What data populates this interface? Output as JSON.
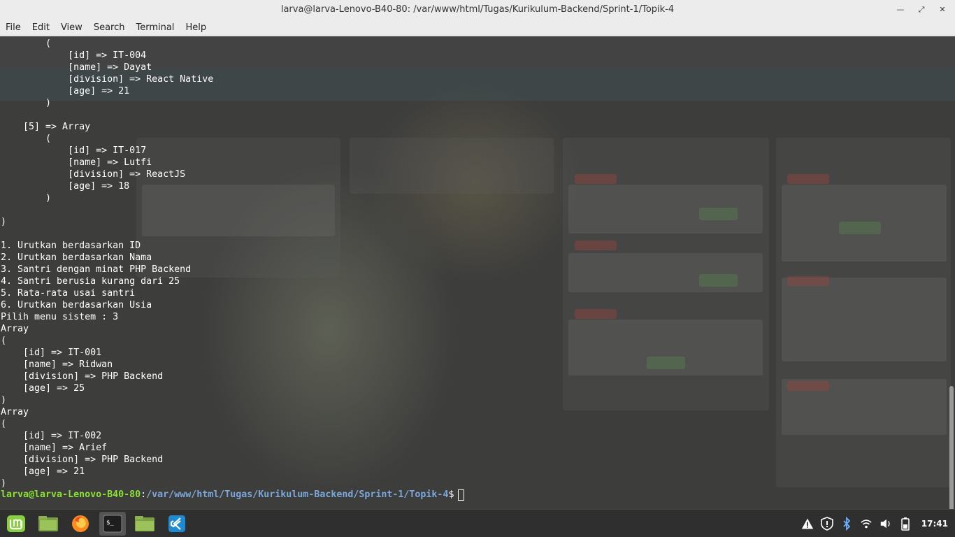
{
  "window": {
    "title": "larva@larva-Lenovo-B40-80: /var/www/html/Tugas/Kurikulum-Backend/Sprint-1/Topik-4"
  },
  "menu": [
    "File",
    "Edit",
    "View",
    "Search",
    "Terminal",
    "Help"
  ],
  "terminal": {
    "output": "        (\n            [id] => IT-004\n            [name] => Dayat\n            [division] => React Native\n            [age] => 21\n        )\n\n    [5] => Array\n        (\n            [id] => IT-017\n            [name] => Lutfi\n            [division] => ReactJS\n            [age] => 18\n        )\n\n)\n\n1. Urutkan berdasarkan ID\n2. Urutkan berdasarkan Nama\n3. Santri dengan minat PHP Backend\n4. Santri berusia kurang dari 25\n5. Rata-rata usai santri\n6. Urutkan berdasarkan Usia\nPilih menu sistem : 3\nArray\n(\n    [id] => IT-001\n    [name] => Ridwan\n    [division] => PHP Backend\n    [age] => 25\n)\nArray\n(\n    [id] => IT-002\n    [name] => Arief\n    [division] => PHP Backend\n    [age] => 21\n)",
    "prompt_user": "larva@larva-Lenovo-B40-80",
    "prompt_sep": ":",
    "prompt_path": "/var/www/html/Tugas/Kurikulum-Backend/Sprint-1/Topik-4",
    "prompt_dollar": "$"
  },
  "taskbar": {
    "apps": [
      "mint-menu-icon",
      "files-icon",
      "firefox-icon",
      "terminal-icon",
      "folder-icon",
      "vscode-icon"
    ],
    "clock": "17:41"
  },
  "colors": {
    "prompt_user": "#8ae234",
    "prompt_path": "#7ba7d9",
    "mint_green": "#87cf3e"
  }
}
